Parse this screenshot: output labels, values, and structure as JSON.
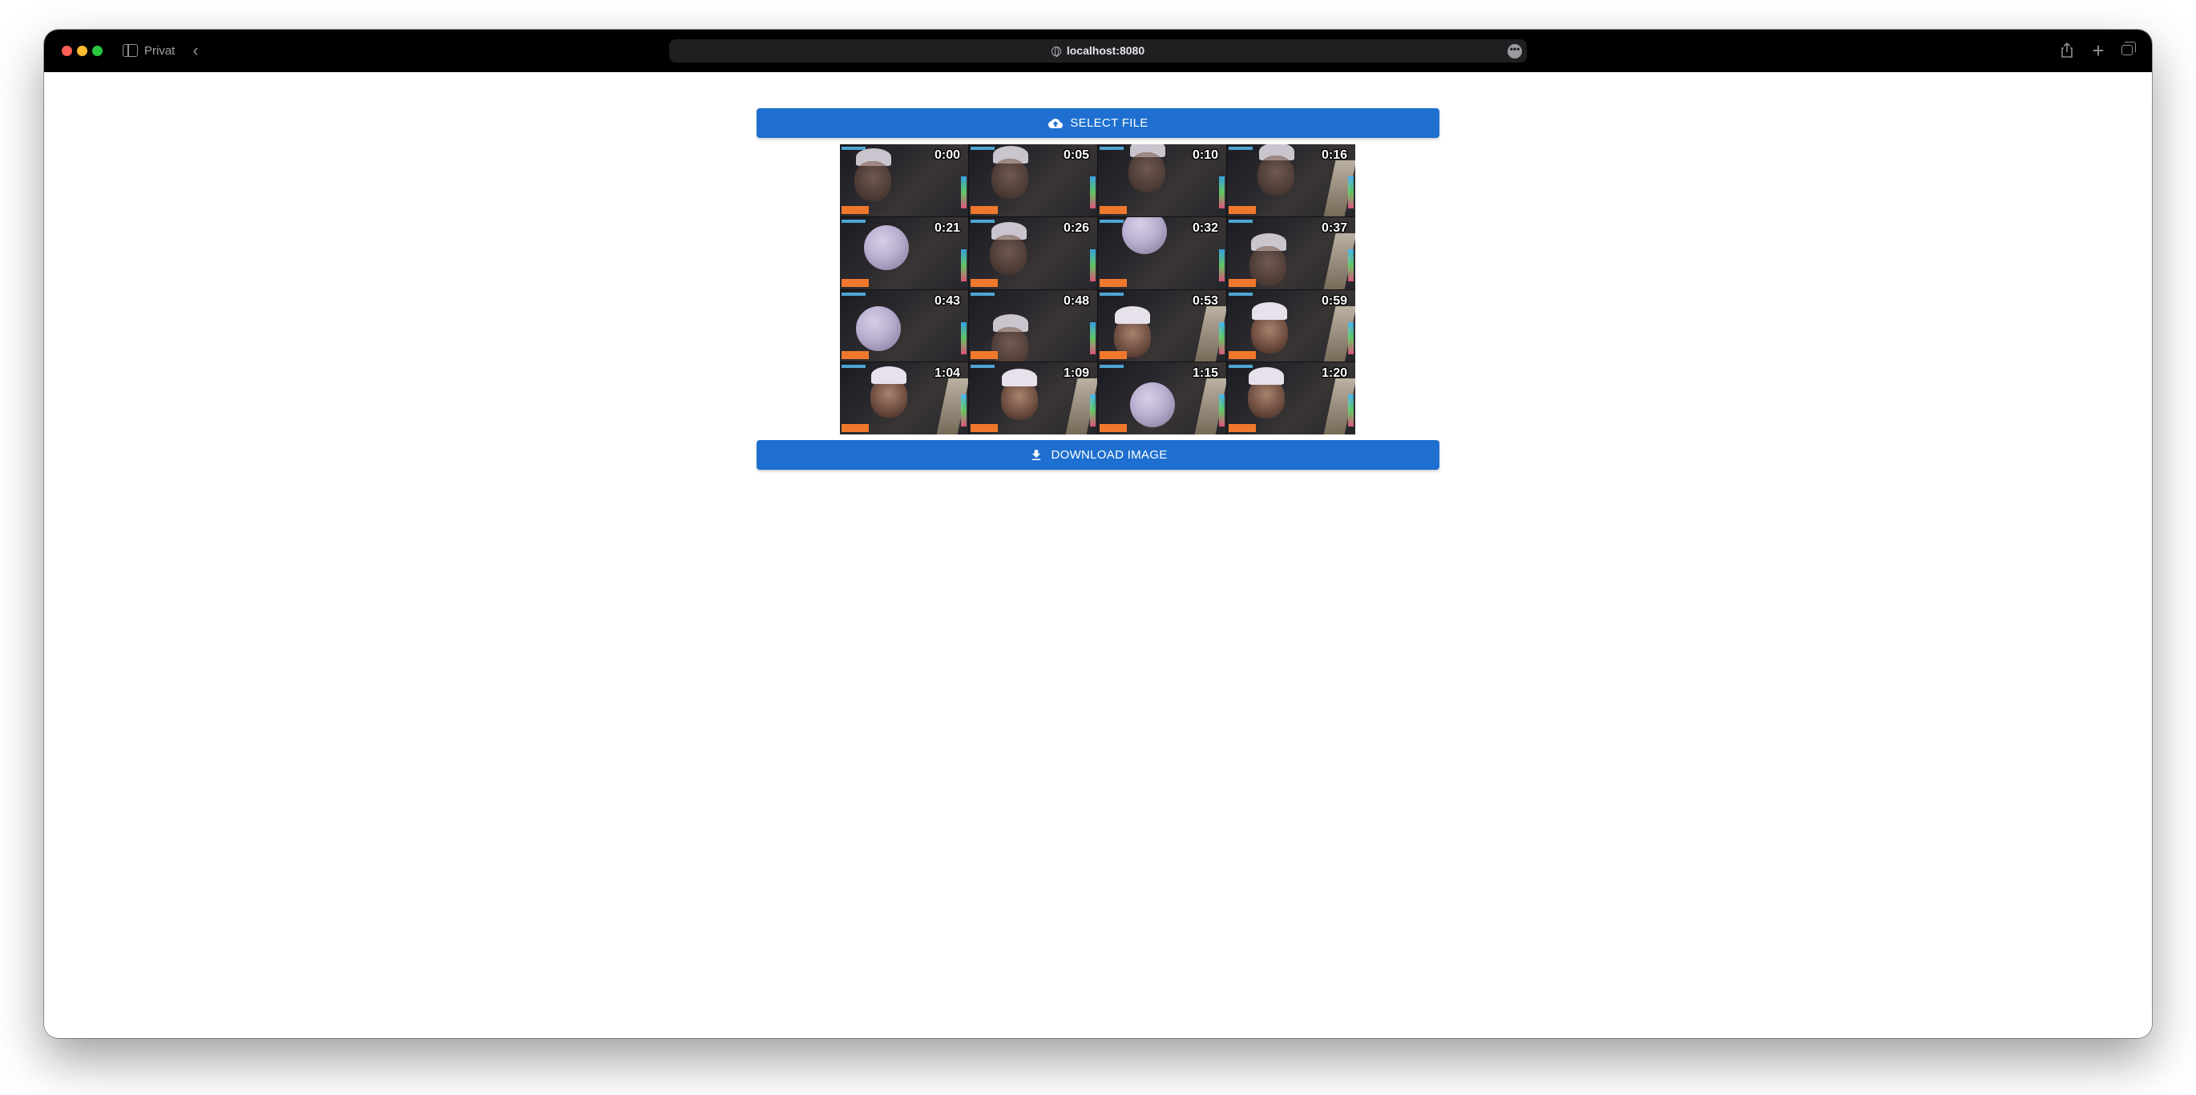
{
  "browser": {
    "profile_label": "Privat",
    "url": "localhost:8080",
    "more_glyph": "•••",
    "back_glyph": "‹",
    "new_tab_glyph": "+",
    "share_glyph": "⇪"
  },
  "page": {
    "select_button_label": "SELECT FILE",
    "download_button_label": "DOWNLOAD IMAGE",
    "accent_color": "#1e6fcf",
    "thumbnail_timestamps": [
      "0:00",
      "0:05",
      "0:10",
      "0:16",
      "0:21",
      "0:26",
      "0:32",
      "0:37",
      "0:43",
      "0:48",
      "0:53",
      "0:59",
      "1:04",
      "1:09",
      "1:15",
      "1:20"
    ]
  }
}
